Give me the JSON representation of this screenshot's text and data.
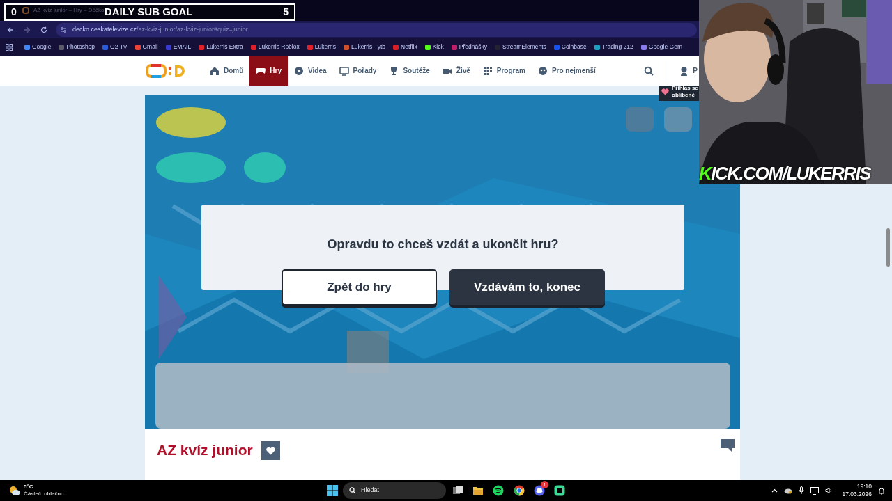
{
  "stream_overlay": {
    "goal_title": "DAILY SUB GOAL",
    "goal_current": "0",
    "goal_target": "5",
    "webcam_caption": "KICK.COM/LUKERRIS"
  },
  "browser": {
    "tab_title": "AZ kvíz junior – Hry – Děčko",
    "url_host": "decko.ceskatelevize.cz",
    "url_path": "/az-kviz-junior/az-kviz-junior#quiz=junior",
    "bookmarks": [
      {
        "label": "Google",
        "color": "#4285f4"
      },
      {
        "label": "Photoshop",
        "color": "#5a5a6a"
      },
      {
        "label": "O2 TV",
        "color": "#2a5bd7"
      },
      {
        "label": "Gmail",
        "color": "#ea4335"
      },
      {
        "label": "EMAIL",
        "color": "#3a3ad0"
      },
      {
        "label": "Lukerris Extra",
        "color": "#e0202a"
      },
      {
        "label": "Lukerris Roblox",
        "color": "#e0202a"
      },
      {
        "label": "Lukerris",
        "color": "#e0202a"
      },
      {
        "label": "Lukerris - ytb",
        "color": "#d0502a"
      },
      {
        "label": "Netflix",
        "color": "#d81f26"
      },
      {
        "label": "Kick",
        "color": "#53fc18"
      },
      {
        "label": "Přednášky",
        "color": "#c0206a"
      },
      {
        "label": "StreamElements",
        "color": "#222233"
      },
      {
        "label": "Coinbase",
        "color": "#1652f0"
      },
      {
        "label": "Trading 212",
        "color": "#1aa0c0"
      },
      {
        "label": "Google Gem",
        "color": "#8a7cf0"
      }
    ]
  },
  "site_nav": {
    "items": [
      {
        "label": "Domů",
        "selected": false
      },
      {
        "label": "Hry",
        "selected": true
      },
      {
        "label": "Videa",
        "selected": false
      },
      {
        "label": "Pořady",
        "selected": false
      },
      {
        "label": "Soutěže",
        "selected": false
      },
      {
        "label": "Živě",
        "selected": false
      },
      {
        "label": "Program",
        "selected": false
      },
      {
        "label": "Pro nejmenší",
        "selected": false
      }
    ],
    "login_label": "P",
    "tooltip": "Přihlas se\noblíbené"
  },
  "dialog": {
    "question": "Opravdu to chceš vzdát a ukončit hru?",
    "buttons": [
      {
        "label": "Zpět do hry",
        "kind": "secondary"
      },
      {
        "label": "Vzdávám to, konec",
        "kind": "primary"
      }
    ]
  },
  "game_title": "AZ kvíz junior",
  "taskbar": {
    "temperature": "5°C",
    "weather": "Částeč. oblačno",
    "search_placeholder": "Hledat",
    "discord_badge": "1",
    "time": "19:10",
    "date": "17.03.2026"
  }
}
